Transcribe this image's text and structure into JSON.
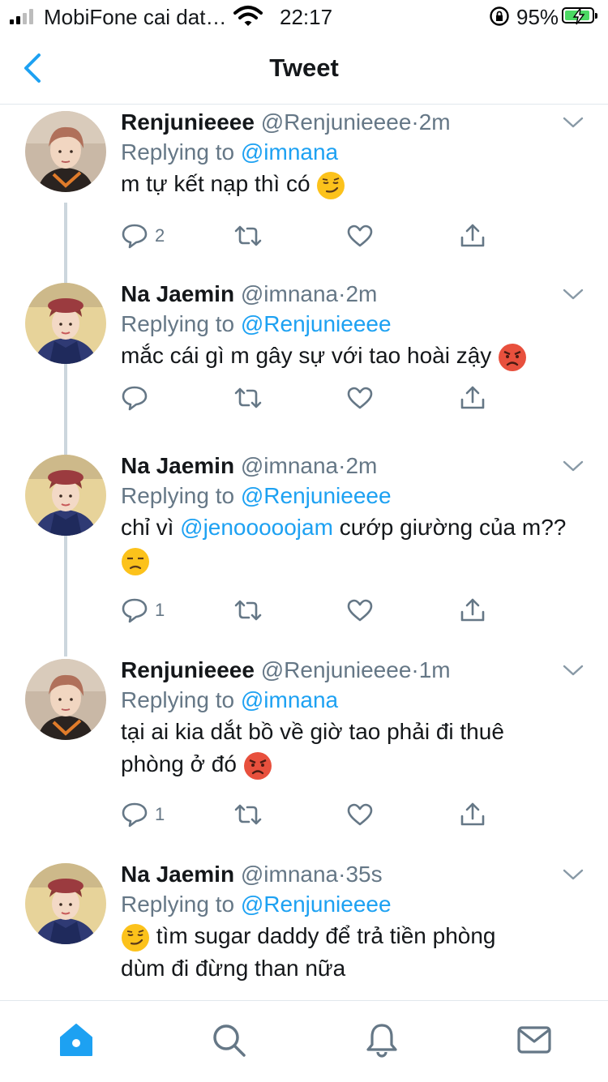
{
  "status_bar": {
    "carrier": "MobiFone cai dat…",
    "time": "22:17",
    "battery_percent": "95%",
    "signal_bars": 4,
    "signal_bars_filled": 2,
    "battery_level": 0.95,
    "battery_color": "#4cd964"
  },
  "nav": {
    "title": "Tweet",
    "back_icon": "chevron-left-icon",
    "accent": "#1da1f2"
  },
  "thread": [
    {
      "name": "Renjunieeee",
      "handle": "@Renjunieeee",
      "sep": "·",
      "time": "2m",
      "reply_prefix": "Replying to",
      "reply_to": "@imnana",
      "lines": [
        {
          "pre": "m tự kết nạp thì có ",
          "emoji": "smirk"
        }
      ],
      "counts": {
        "reply": "2",
        "retweet": "",
        "like": ""
      },
      "avatar": "renjun"
    },
    {
      "name": "Na Jaemin",
      "handle": "@imnana",
      "sep": "·",
      "time": "2m",
      "reply_prefix": "Replying to",
      "reply_to": "@Renjunieeee",
      "lines": [
        {
          "pre": "mắc cái gì m gây sự với tao hoài zậy ",
          "emoji": "angry"
        }
      ],
      "counts": {
        "reply": "",
        "retweet": "",
        "like": ""
      },
      "avatar": "jaemin"
    },
    {
      "name": "Na Jaemin",
      "handle": "@imnana",
      "sep": "·",
      "time": "2m",
      "reply_prefix": "Replying to",
      "reply_to": "@Renjunieeee",
      "lines": [
        {
          "pre": "chỉ vì ",
          "mention": "@jenooooojam",
          "post": " cướp giường của m??"
        },
        {
          "emoji": "unamused"
        }
      ],
      "counts": {
        "reply": "1",
        "retweet": "",
        "like": ""
      },
      "avatar": "jaemin"
    },
    {
      "name": "Renjunieeee",
      "handle": "@Renjunieeee",
      "sep": "·",
      "time": "1m",
      "reply_prefix": "Replying to",
      "reply_to": "@imnana",
      "lines": [
        {
          "pre": "tại ai kia dắt bồ về giờ tao phải đi thuê"
        },
        {
          "pre": "phòng ở đó ",
          "emoji": "angry"
        }
      ],
      "counts": {
        "reply": "1",
        "retweet": "",
        "like": ""
      },
      "avatar": "renjun"
    },
    {
      "name": "Na Jaemin",
      "handle": "@imnana",
      "sep": "·",
      "time": "35s",
      "reply_prefix": "Replying to",
      "reply_to": "@Renjunieeee",
      "lines": [
        {
          "emoji_first": "smirk",
          "pre": " tìm sugar daddy để trả tiền phòng"
        },
        {
          "pre": "dùm đi đừng than nữa"
        }
      ],
      "counts": {
        "reply": "",
        "retweet": "",
        "like": ""
      },
      "avatar": "jaemin"
    }
  ],
  "tab_bar": {
    "items": [
      "home-icon",
      "search-icon",
      "notifications-icon",
      "messages-icon"
    ],
    "active": "home-icon"
  }
}
